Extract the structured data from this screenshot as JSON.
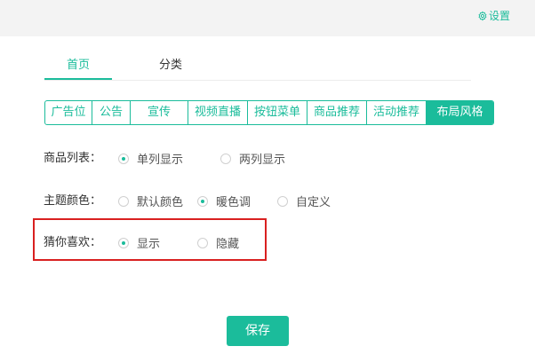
{
  "header": {
    "settings_label": "设置",
    "settings_icon": "gear-icon"
  },
  "tabs": [
    {
      "label": "首页",
      "active": true
    },
    {
      "label": "分类",
      "active": false
    }
  ],
  "sections": [
    {
      "label": "广告位",
      "active": false
    },
    {
      "label": "公告",
      "active": false
    },
    {
      "label": "宣传",
      "active": false
    },
    {
      "label": "视频直播",
      "active": false
    },
    {
      "label": "按钮菜单",
      "active": false
    },
    {
      "label": "商品推荐",
      "active": false
    },
    {
      "label": "活动推荐",
      "active": false
    },
    {
      "label": "布局风格",
      "active": true
    }
  ],
  "settings": {
    "product_list": {
      "label": "商品列表：",
      "options": [
        {
          "label": "单列显示",
          "checked": true
        },
        {
          "label": "两列显示",
          "checked": false
        }
      ]
    },
    "theme_color": {
      "label": "主题颜色：",
      "options": [
        {
          "label": "默认颜色",
          "checked": false
        },
        {
          "label": "暖色调",
          "checked": true
        },
        {
          "label": "自定义",
          "checked": false
        }
      ]
    },
    "guess_you_like": {
      "label": "猜你喜欢：",
      "options": [
        {
          "label": "显示",
          "checked": true
        },
        {
          "label": "隐藏",
          "checked": false
        }
      ]
    }
  },
  "actions": {
    "save_label": "保存"
  },
  "colors": {
    "accent": "#1bbc9b",
    "highlight_border": "#d92020",
    "topbar_bg": "#f3f3f3"
  }
}
